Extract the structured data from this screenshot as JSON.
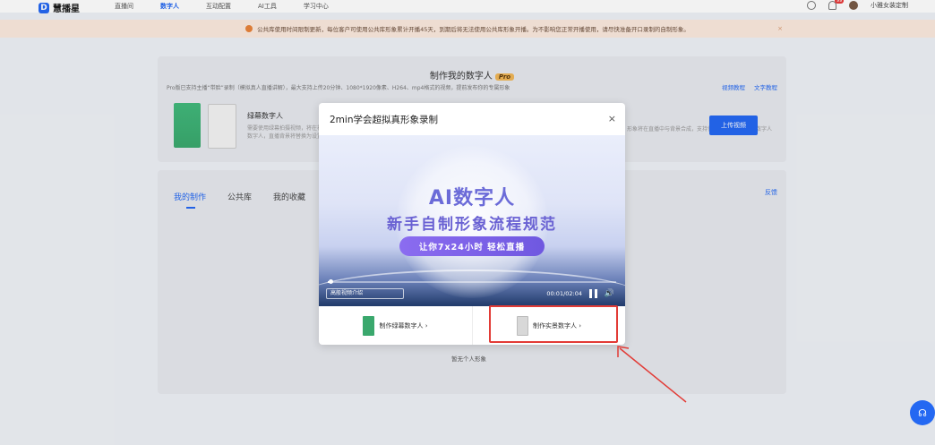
{
  "app": {
    "logo_text": "慧播星",
    "nav": [
      "直播间",
      "数字人",
      "互动配置",
      "AI工具",
      "学习中心"
    ],
    "active_nav": "数字人",
    "notification_count": "99",
    "username": "小雅女装定制"
  },
  "notice": {
    "text": "公共库使用时间限制更新，每位客户可使用公共库形象累计开播45天，到期后将无法使用公共库形象开播。为不影响您正常开播使用，请尽快准备开口录制的自制形象。",
    "close": "×"
  },
  "create": {
    "title": "制作我的数字人",
    "pro": "Pro",
    "subtitle": "Pro版已支持主播“带脸”录制（模拟真人直播讲解），最大支持上传20分钟、1080*1920像素、H264、mp4格式的视频，提前发布你的专属形象",
    "video_tutorial": "视频教程",
    "text_tutorial": "文字教程",
    "green_title": "绿幕数字人",
    "green_desc_line1": "需要使用绿幕拍摄视频，将在视频中抠出人像",
    "green_desc_line2": "数字人，直播背景将替换为设置的背景",
    "right_desc": "形象将在直播中与背景合成，支持使用背景更加灵活的数字人",
    "upload": "上传视频"
  },
  "list": {
    "tabs": [
      "我的制作",
      "公共库",
      "我的收藏"
    ],
    "feedback": "反馈",
    "empty": "暂无个人形象"
  },
  "modal": {
    "title": "2min学会超拟真形象录制",
    "close": "×",
    "video_heading": "AI数字人",
    "video_subheading": "新手自制形象流程规范",
    "video_pill": "让你7x24小时 轻松直播",
    "speed_label": "高般视频介绍",
    "time": "00:01/02:04",
    "progress": 0.01,
    "option_green": "制作绿幕数字人 ›",
    "option_real": "制作实景数字人 ›"
  },
  "colors": {
    "primary": "#2468f2",
    "highlight": "#e23b36"
  }
}
